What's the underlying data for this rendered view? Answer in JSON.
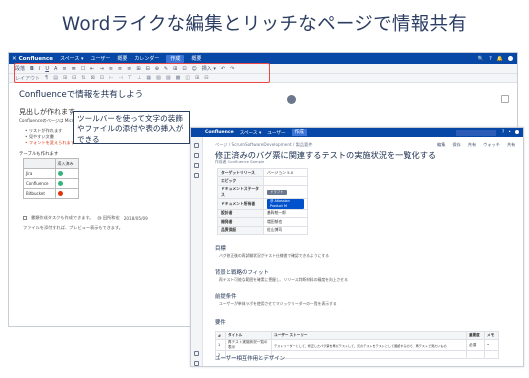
{
  "headline": "Wordライクな編集とリッチなページで情報共有",
  "editor": {
    "nav": {
      "logo": "Confluence",
      "items": [
        "スペース ▾",
        "ユーザー",
        "概要",
        "カレンダー"
      ],
      "create": "作成",
      "extra": "概要"
    },
    "toolbar": {
      "style": "段落",
      "icons1": [
        "B",
        "I",
        "U",
        "A",
        "≡",
        "≣",
        "☐",
        "⇤",
        "⇥",
        "≡",
        "≡",
        "≡",
        "⊞",
        "⊟",
        "⊕",
        "✎",
        "⊞",
        "⊡",
        "☺",
        "挿入 ▾",
        "↶",
        "↷"
      ],
      "icons2": [
        "レイアウト",
        "¶",
        "▤",
        "⊞",
        "⊟",
        "⇅",
        "⊠",
        "⊡",
        "⊢",
        "⊣",
        "⊤",
        "⊥",
        "▦",
        "▧",
        "▨",
        "▩",
        "◫",
        "⊞",
        "⊟"
      ]
    },
    "title": "Confluenceで情報を共有しよう",
    "heading": "見出しが作れます",
    "paragraph": "Confluenceのページは Microsoft Word のような感覚で作ることができます",
    "bullets": [
      "リストが作れます",
      "見やすい文書",
      "フォントを変えられます"
    ],
    "table_caption": "テーブルも作れます",
    "table_header": "導入済み",
    "table_rows": [
      {
        "name": "Jira",
        "status": "ok"
      },
      {
        "name": "Confluence",
        "status": "ok"
      },
      {
        "name": "Bitbucket",
        "status": "ng"
      }
    ],
    "task": "書類作成タスクも作成できます。",
    "task_user": "@ 田所和宏",
    "task_date": "2018/05/09",
    "footer": "ファイルを添付すれば、プレビュー表示もできます。"
  },
  "callout": "ツールバーを使って文字の装飾やファイルの添付や表の挿入ができる",
  "view": {
    "nav": {
      "items": [
        "Confluence",
        "スペース ▾",
        "ユーザー"
      ],
      "create": "作成",
      "extra": "検索"
    },
    "breadcrumb": "ページ / ScrumSoftwareDevelopment / 製品要件",
    "actions": [
      "編集",
      "保存",
      "共有",
      "ウォッチ",
      "共有"
    ],
    "title": "修正済みのバグ票に関連するテストの実施状況を一覧化する",
    "meta": "作成者 Confluence Sample",
    "properties": [
      {
        "key": "ターゲットリリース",
        "value": "バージョン 5.0",
        "type": "text"
      },
      {
        "key": "エピック",
        "value": "",
        "type": "text"
      },
      {
        "key": "ドキュメントステータス",
        "value": "ドラフト",
        "type": "lozenge",
        "color": "#6b778c"
      },
      {
        "key": "ドキュメント所有者",
        "value": "@ Atlassian Product M",
        "type": "lozenge",
        "color": "#0052cc"
      },
      {
        "key": "設計者",
        "value": "基幹統一郎",
        "type": "text"
      },
      {
        "key": "開発者",
        "value": "増田郁也",
        "type": "text"
      },
      {
        "key": "品質保証",
        "value": "佐山博司",
        "type": "text"
      }
    ],
    "sections": [
      {
        "title": "目標",
        "text": "バグ修正後の再試験状況がテスト仕様書で確認できるようにする"
      },
      {
        "title": "背景と戦略のフィット",
        "text": "再テスト可能な範囲を確実に把握し、リリース判断材料の精度を向上させる"
      },
      {
        "title": "前提条件",
        "text": "ユーザーが単体ラボを使用させてマジックリーダーの一覧を表示する"
      }
    ],
    "req_title": "要件",
    "req_headers": [
      "#",
      "タイトル",
      "ユーザー ストーリー",
      "重要度",
      "メモ"
    ],
    "req_rows": [
      {
        "n": "1",
        "title": "再テスト実施状況一覧の表示",
        "story": "テストリーダーとして、修正したバグ票を再びテストして、元のテストをテストとして確認するので、再テストで見たいもの",
        "prio": "必須",
        "note": "•"
      },
      {
        "n": "2",
        "title": "",
        "story": "",
        "prio": "",
        "note": ""
      }
    ],
    "last_section": "ユーザー相互作用とデザイン"
  }
}
